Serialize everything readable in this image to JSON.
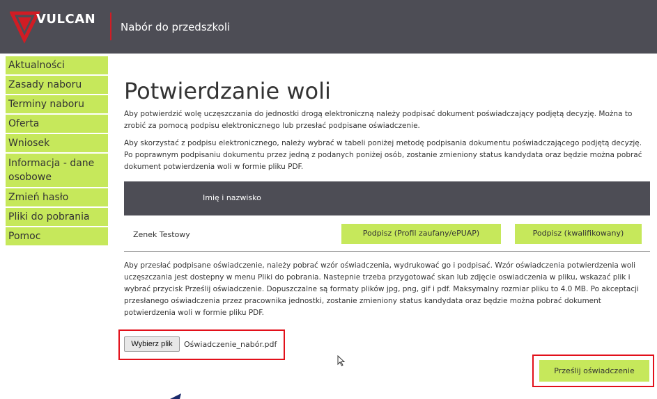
{
  "header": {
    "brand": "VULCAN",
    "app_title": "Nabór do przedszkoli"
  },
  "sidebar": {
    "items": [
      {
        "label": "Aktualności"
      },
      {
        "label": "Zasady naboru"
      },
      {
        "label": "Terminy naboru"
      },
      {
        "label": "Oferta"
      },
      {
        "label": "Wniosek"
      },
      {
        "label": "Informacja - dane osobowe"
      },
      {
        "label": "Zmień hasło"
      },
      {
        "label": "Pliki do pobrania"
      },
      {
        "label": "Pomoc"
      }
    ]
  },
  "main": {
    "title": "Potwierdzanie woli",
    "intro1": "Aby potwierdzić wolę uczęszczania do jednostki drogą elektroniczną należy podpisać dokument poświadczający podjętą decyzję. Można to zrobić za pomocą podpisu elektronicznego lub przesłać podpisane oświadczenie.",
    "intro2": "Aby skorzystać z podpisu elektronicznego, należy wybrać w tabeli poniżej metodę podpisania dokumentu poświadczającego podjętą decyzję. Po poprawnym podpisaniu dokumentu przez jedną z podanych poniżej osób, zostanie zmieniony status kandydata oraz będzie można pobrać dokument potwierdzenia woli w formie pliku PDF.",
    "table": {
      "header": "Imię i nazwisko",
      "row": {
        "name": "Zenek Testowy",
        "btn_profile": "Podpisz (Profil zaufany/ePUAP)",
        "btn_qualified": "Podpisz (kwalifikowany)"
      }
    },
    "upload_info": "Aby przesłać podpisane oświadczenie, należy pobrać wzór oświadczenia, wydrukować go i podpisać. Wzór oświadczenia potwierdzenia woli uczęszczania jest dostepny w menu Pliki do pobrania. Nastepnie trzeba przygotować skan lub zdjęcie oswiadczenia w pliku, wskazać plik i wybrać przycisk Prześlij oświadczenie. Dopuszczalne są formaty plików jpg, png, gif i pdf. Maksymalny rozmiar pliku to 4.0 MB. Po akceptacji przesłanego oświadczenia przez pracownika jednostki, zostanie zmieniony status kandydata oraz będzie można pobrać dokument potwierdzenia woli w formie pliku PDF.",
    "file_button": "Wybierz plik",
    "file_name": "Oświadczenie_nabór.pdf",
    "submit_button": "Prześlij oświadczenie"
  },
  "colors": {
    "header_bg": "#4d4d55",
    "accent_green": "#c6e85b",
    "highlight_red": "#e2101a",
    "logo_red": "#d11c24"
  }
}
